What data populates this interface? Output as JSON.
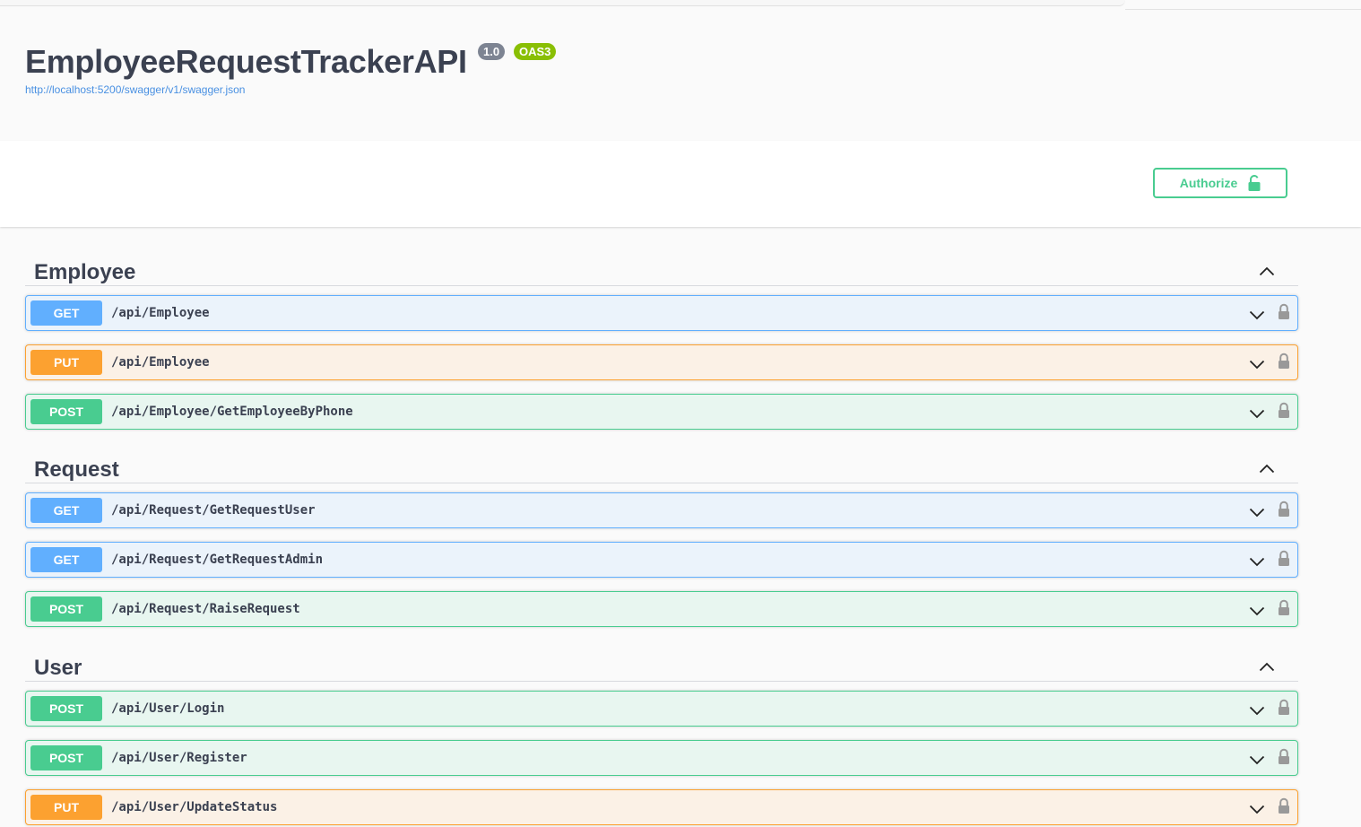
{
  "info": {
    "title": "EmployeeRequestTrackerAPI",
    "version": "1.0",
    "oas": "OAS3",
    "spec_url": "http://localhost:5200/swagger/v1/swagger.json"
  },
  "authorize": {
    "label": "Authorize"
  },
  "colors": {
    "get": "#61affe",
    "put": "#fca130",
    "post": "#49cc90"
  },
  "tags": [
    {
      "name": "Employee",
      "operations": [
        {
          "method": "GET",
          "path": "/api/Employee"
        },
        {
          "method": "PUT",
          "path": "/api/Employee"
        },
        {
          "method": "POST",
          "path": "/api/Employee/GetEmployeeByPhone"
        }
      ]
    },
    {
      "name": "Request",
      "operations": [
        {
          "method": "GET",
          "path": "/api/Request/GetRequestUser"
        },
        {
          "method": "GET",
          "path": "/api/Request/GetRequestAdmin"
        },
        {
          "method": "POST",
          "path": "/api/Request/RaiseRequest"
        }
      ]
    },
    {
      "name": "User",
      "operations": [
        {
          "method": "POST",
          "path": "/api/User/Login"
        },
        {
          "method": "POST",
          "path": "/api/User/Register"
        },
        {
          "method": "PUT",
          "path": "/api/User/UpdateStatus"
        }
      ]
    }
  ]
}
